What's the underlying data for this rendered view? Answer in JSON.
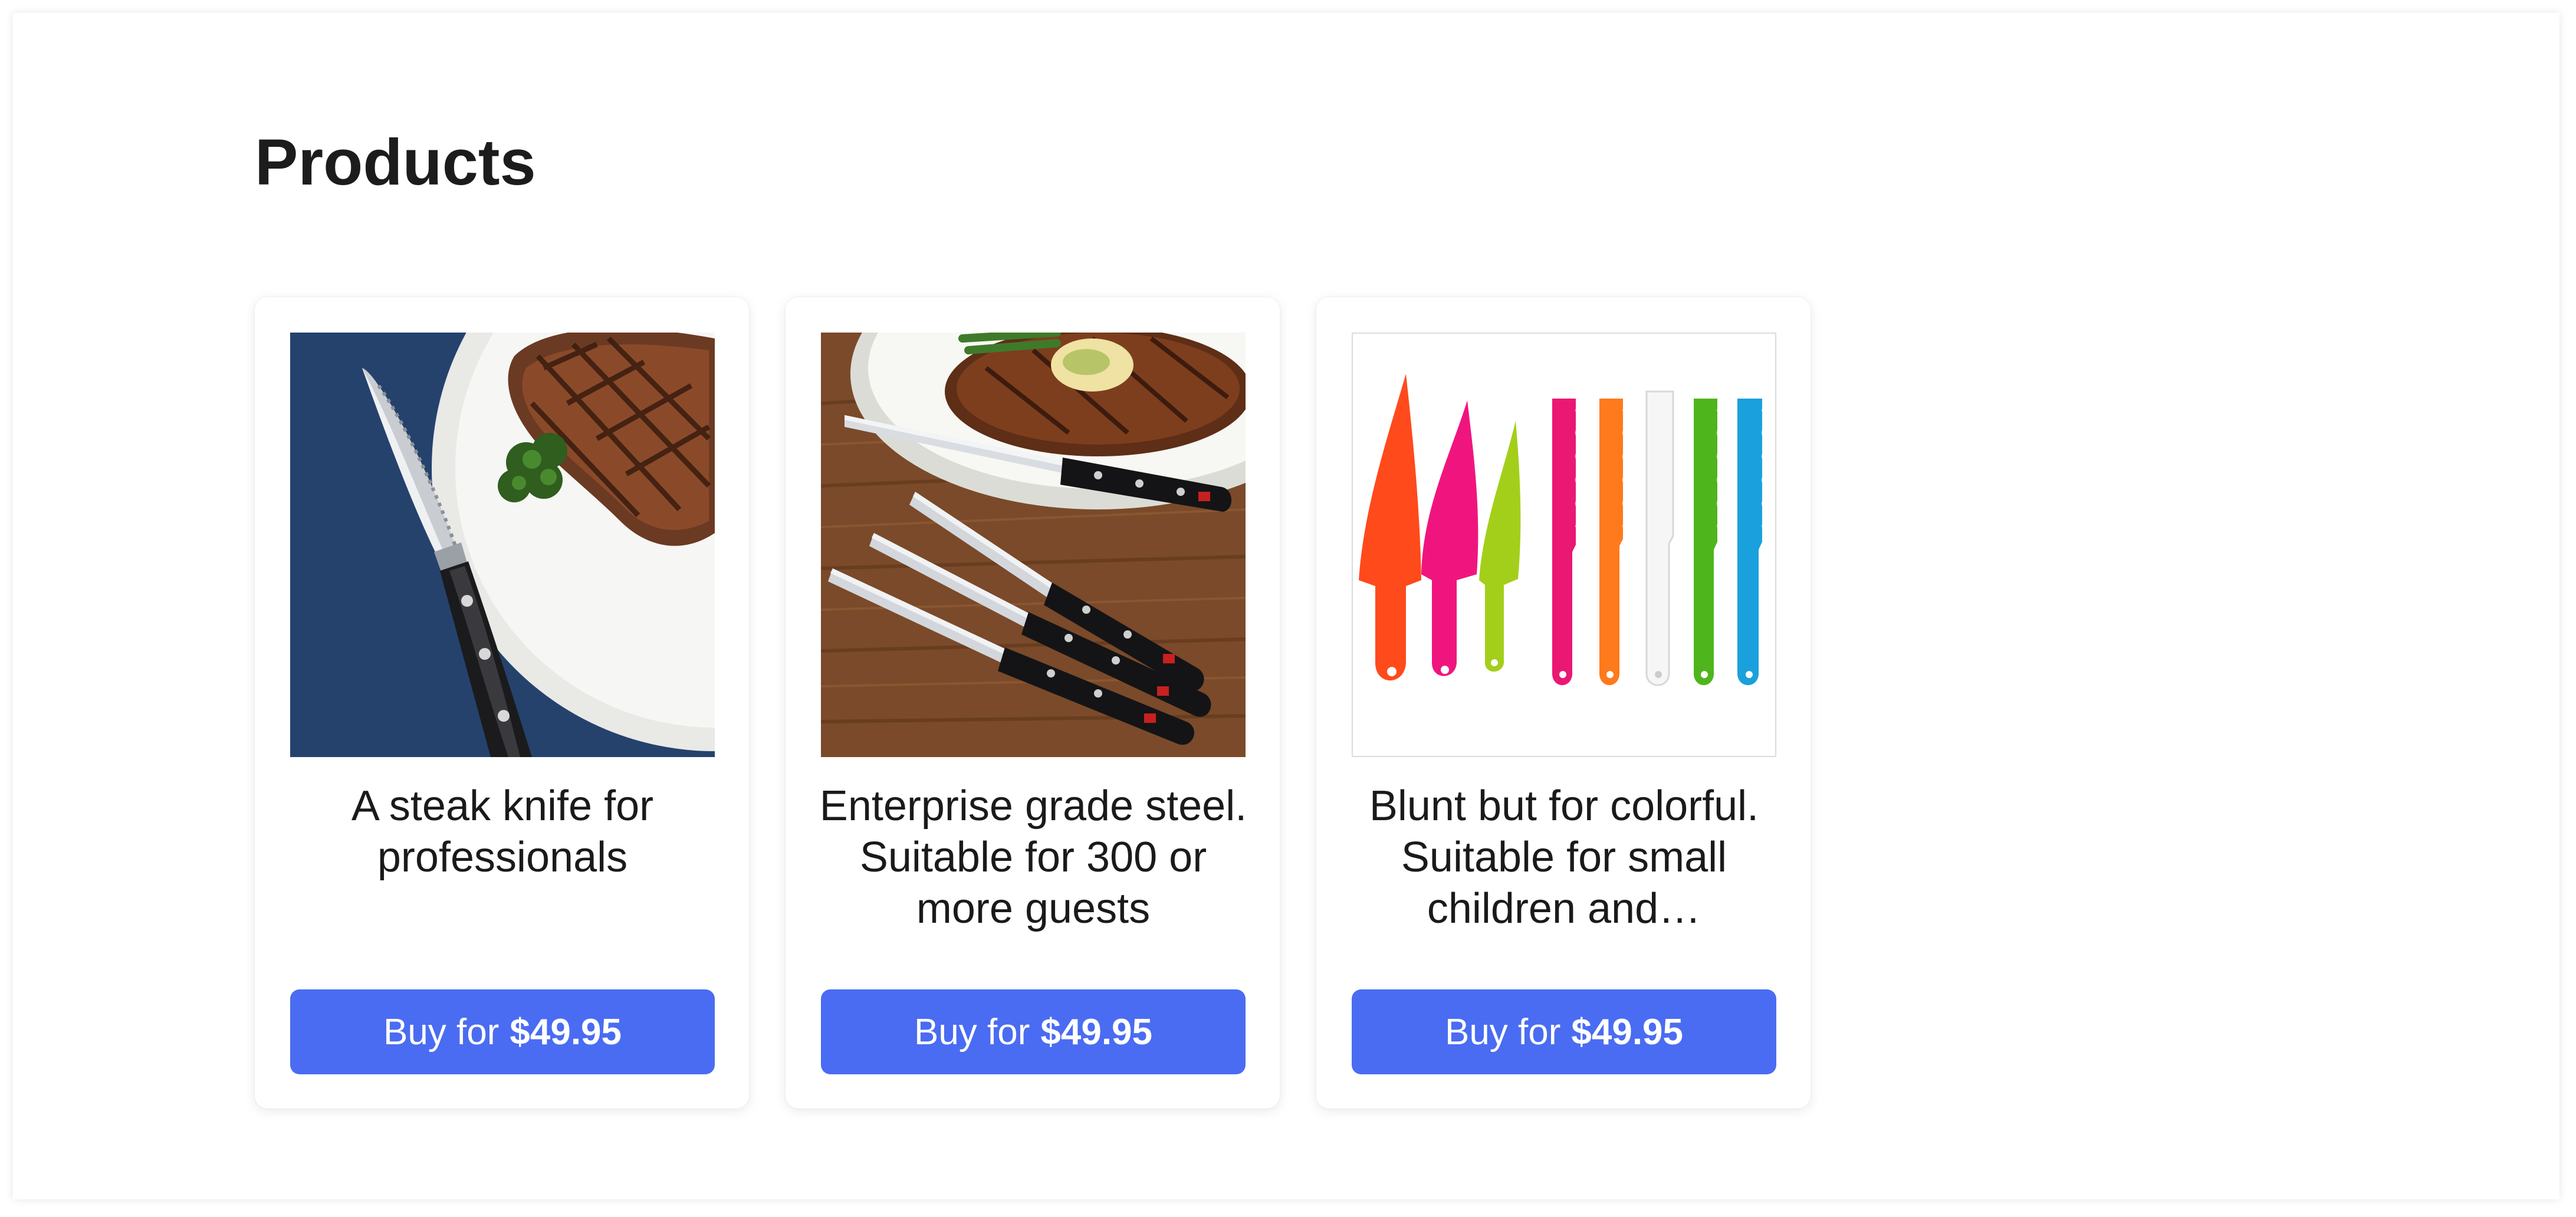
{
  "page": {
    "title": "Products"
  },
  "products": [
    {
      "image_alt": "steak-knife-photo",
      "description": "A steak knife for professionals",
      "button_label": "Buy for",
      "price": "$49.95"
    },
    {
      "image_alt": "steak-knife-set-photo",
      "description": "Enterprise grade steel. Suitable for 300 or more guests",
      "button_label": "Buy for",
      "price": "$49.95"
    },
    {
      "image_alt": "colorful-kids-knives-photo",
      "description": "Blunt but for colorful. Suitable for small children and…",
      "button_label": "Buy for",
      "price": "$49.95"
    }
  ],
  "colors": {
    "button": "#4a6cf2",
    "text": "#1a1a1a"
  }
}
